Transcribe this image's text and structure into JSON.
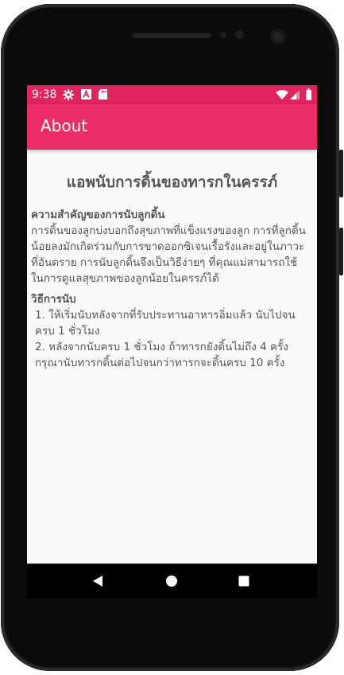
{
  "status_bar": {
    "time": "9:38",
    "left_icons": [
      "gear-icon",
      "a-notification-icon",
      "sd-card-icon"
    ],
    "right_icons": [
      "wifi-icon",
      "signal-icon",
      "battery-icon"
    ],
    "color": "#e0245e"
  },
  "app_bar": {
    "title": "About",
    "color": "#ed2d67"
  },
  "content": {
    "heading": "แอพนับการดิ้นของทารกในครรภ์",
    "importance": {
      "title": "ความสำคัญของการนับลูกดิ้น",
      "lines": [
        "การดิ้นของลูกบ่งบอกถึงสุขภาพที่แข็งแรงของลูก การที่ลูกดิ้น",
        "น้อยลงมักเกิดร่วมกับการขาดออกซิเจนเรื้อรังและอยู่ในภาวะ",
        "ที่อันตราย การนับลูกดิ้นจึงเป็นวิธีง่ายๆ ที่คุณแม่สามารถใช้",
        "ในการดูแลสุขภาพของลูกน้อยในครรภ์ได้"
      ]
    },
    "method": {
      "title": "วิธีการนับ",
      "steps": [
        {
          "line1": "1. ให้เริ่มนับหลังจากที่รับประทานอาหารอิ่มแล้ว นับไปจน",
          "line2": "ครบ 1 ชั่วโมง"
        },
        {
          "line1": "2. หลังจากนับครบ 1 ชั่วโมง ถ้าทารกยังดิ้นไม่ถึง 4 ครั้ง",
          "line2": "กรุณานับทารกดิ้นต่อไปจนกว่าทารกจะดิ้นครบ 10 ครั้ง"
        }
      ]
    }
  },
  "nav_bar": {
    "buttons": [
      "back-icon",
      "home-icon",
      "recents-icon"
    ]
  }
}
